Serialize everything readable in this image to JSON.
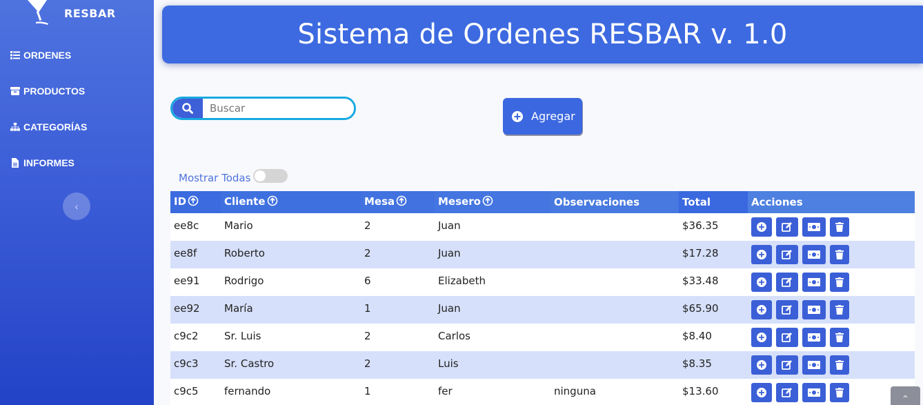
{
  "brand": {
    "name": "RESBAR"
  },
  "sidebar": {
    "items": [
      {
        "label": "ORDENES",
        "icon": "list-icon"
      },
      {
        "label": "PRODUCTOS",
        "icon": "box-icon"
      },
      {
        "label": "CATEGORÍAS",
        "icon": "sitemap-icon"
      },
      {
        "label": "INFORMES",
        "icon": "file-icon"
      }
    ]
  },
  "header": {
    "title": "Sistema de Ordenes RESBAR v. 1.0"
  },
  "search": {
    "placeholder": "Buscar"
  },
  "add_button": {
    "label": "Agregar"
  },
  "show_all": {
    "label": "Mostrar Todas",
    "checked": false
  },
  "table": {
    "columns": [
      "ID",
      "Cliente",
      "Mesa",
      "Mesero",
      "Observaciones",
      "Total",
      "Acciones"
    ],
    "rows": [
      {
        "id": "ee8c",
        "cliente": "Mario",
        "mesa": "2",
        "mesero": "Juan",
        "obs": "",
        "total": "$36.35"
      },
      {
        "id": "ee8f",
        "cliente": "Roberto",
        "mesa": "2",
        "mesero": "Juan",
        "obs": "",
        "total": "$17.28"
      },
      {
        "id": "ee91",
        "cliente": "Rodrigo",
        "mesa": "6",
        "mesero": "Elizabeth",
        "obs": "",
        "total": "$33.48"
      },
      {
        "id": "ee92",
        "cliente": "María",
        "mesa": "1",
        "mesero": "Juan",
        "obs": "",
        "total": "$65.90"
      },
      {
        "id": "c9c2",
        "cliente": "Sr. Luis",
        "mesa": "2",
        "mesero": "Carlos",
        "obs": "",
        "total": "$8.40"
      },
      {
        "id": "c9c3",
        "cliente": "Sr. Castro",
        "mesa": "2",
        "mesero": "Luis",
        "obs": "",
        "total": "$8.35"
      },
      {
        "id": "c9c5",
        "cliente": "fernando",
        "mesa": "1",
        "mesero": "fer",
        "obs": "ninguna",
        "total": "$13.60"
      }
    ]
  },
  "colors": {
    "primary": "#4e73df",
    "header_bg": "#3d6ae0",
    "row_alt": "#d6e0fa",
    "search_border": "#17a9e0"
  }
}
